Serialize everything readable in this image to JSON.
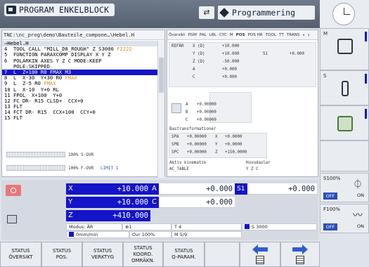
{
  "header": {
    "mode_label": "PROGRAM ENKELBLOCK",
    "active_mode_label": "Programmering",
    "swap_glyph": "⇄"
  },
  "program": {
    "path": "TNC:\\nc_prog\\demo\\Bauteile_compone…\\Hebel.H",
    "lines": [
      {
        "text": "→Hebel.H",
        "kind": "first"
      },
      {
        "text": "4  TOOL CALL \"MILL_D8_ROUGH\" Z S3000 ",
        "red": "",
        "orange": "F2222"
      },
      {
        "text": "5  FUNCTION PARAXCOMP DISPLAY X Y Z"
      },
      {
        "text": "6  POLARKIN AXES Y Z C MODE:KEEP"
      },
      {
        "text": "   POLE:SKIPPED"
      },
      {
        "text": "7  L  Z+100 R0 FMAX M3",
        "kind": "sel"
      },
      {
        "text": "8  L  X-30  Y+30 R0 ",
        "orange": "FMAX"
      },
      {
        "text": "9  L  Z-5 R0 ",
        "orange": "FMAX"
      },
      {
        "text": "10 L  X-10  Y+0 RL"
      },
      {
        "text": "11 FPOL  X+100  Y+0"
      },
      {
        "text": "12 FC DR- R15 CLSD+  CCX+0"
      },
      {
        "text": "13 FLT"
      },
      {
        "text": "14 FCT DR- R15  CCX+100  CCY+0"
      },
      {
        "text": "15 FLT"
      }
    ],
    "s_ovr": "100% S-OVR",
    "f_ovr": "100% F-OVR",
    "limit": "LIMIT 1"
  },
  "status": {
    "tabs": [
      "Översikt",
      "PGM",
      "PAL",
      "LBL",
      "CYC",
      "M",
      "POS",
      "POS HR",
      "TOOL",
      "TT",
      "TRANS"
    ],
    "active_tab": "POS",
    "ref_label": "REFÄR",
    "ref_rows": [
      {
        "axis": "X (D)",
        "value": "+10.000",
        "extra_label": "",
        "extra_value": ""
      },
      {
        "axis": "Y (D)",
        "value": "+10.000",
        "extra_label": "S1",
        "extra_value": "+0.000"
      },
      {
        "axis": "Z (D)",
        "value": "-50.000",
        "extra_label": "",
        "extra_value": ""
      },
      {
        "axis": "A",
        "value": "+0.000",
        "extra_label": "",
        "extra_value": ""
      },
      {
        "axis": "C",
        "value": "+0.000",
        "extra_label": "",
        "extra_value": ""
      }
    ],
    "rot_rows": [
      {
        "axis": "A",
        "value": "+0.00000"
      },
      {
        "axis": "B",
        "value": "+0.00000"
      },
      {
        "axis": "C",
        "value": "+0.00000"
      }
    ],
    "base_title": "Bastransformationer",
    "base_rows": [
      {
        "name": "SPA",
        "v1": "+0.00000",
        "axis": "X",
        "v2": "+0.0000"
      },
      {
        "name": "SPB",
        "v1": "+0.00000",
        "axis": "Y",
        "v2": "+0.0000"
      },
      {
        "name": "SPC",
        "v1": "+0.00000",
        "axis": "Z",
        "v2": "+150.0000"
      }
    ],
    "kin_label": "Aktiv kinematik",
    "kin_value": "AC_TABLE",
    "main_axes_label": "Huvudaxlar",
    "main_axes_value": "Y Z C"
  },
  "positions": {
    "left": [
      {
        "axis": "X",
        "value": "+10.000"
      },
      {
        "axis": "Y",
        "value": "+10.000"
      },
      {
        "axis": "Z",
        "value": "+410.000"
      }
    ],
    "right": [
      {
        "axis": "A",
        "value": "+0.000"
      },
      {
        "axis": "C",
        "value": "+0.000"
      }
    ],
    "s1": {
      "axis": "S1",
      "value": "+0.000"
    },
    "info": {
      "mode": "Modus: ÄR",
      "mode_icon": "⊕1",
      "feed": "0mm/min",
      "ovr": "Ovr 100%",
      "tool": "T 4",
      "m": "M 5/9",
      "spindle": "S 3000"
    }
  },
  "right_softkeys": {
    "m_label": "M",
    "s_label": "S",
    "s_override": {
      "title": "S100%",
      "off": "OFF",
      "on": "ON"
    },
    "f_override": {
      "title": "F100%",
      "off": "OFF",
      "on": "ON"
    }
  },
  "bottom_softkeys": [
    {
      "l1": "STATUS",
      "l2": "ÖVERSIKT"
    },
    {
      "l1": "STATUS",
      "l2": "POS."
    },
    {
      "l1": "STATUS",
      "l2": "VERKTYG"
    },
    {
      "l1": "STATUS",
      "l2": "KOORD.",
      "l3": "OMRÄKN."
    },
    {
      "l1": "STATUS",
      "l2": "Q-PARAM."
    },
    {
      "l1": "",
      "l2": ""
    },
    {
      "l1": "",
      "l2": ""
    },
    {
      "l1": "",
      "l2": ""
    }
  ],
  "colors": {
    "accent": "#1414c8",
    "softkey_arrow": "#2c5fd0",
    "feed_highlight": "#e08a1e",
    "tool_call_highlight": "#c81e1e"
  }
}
